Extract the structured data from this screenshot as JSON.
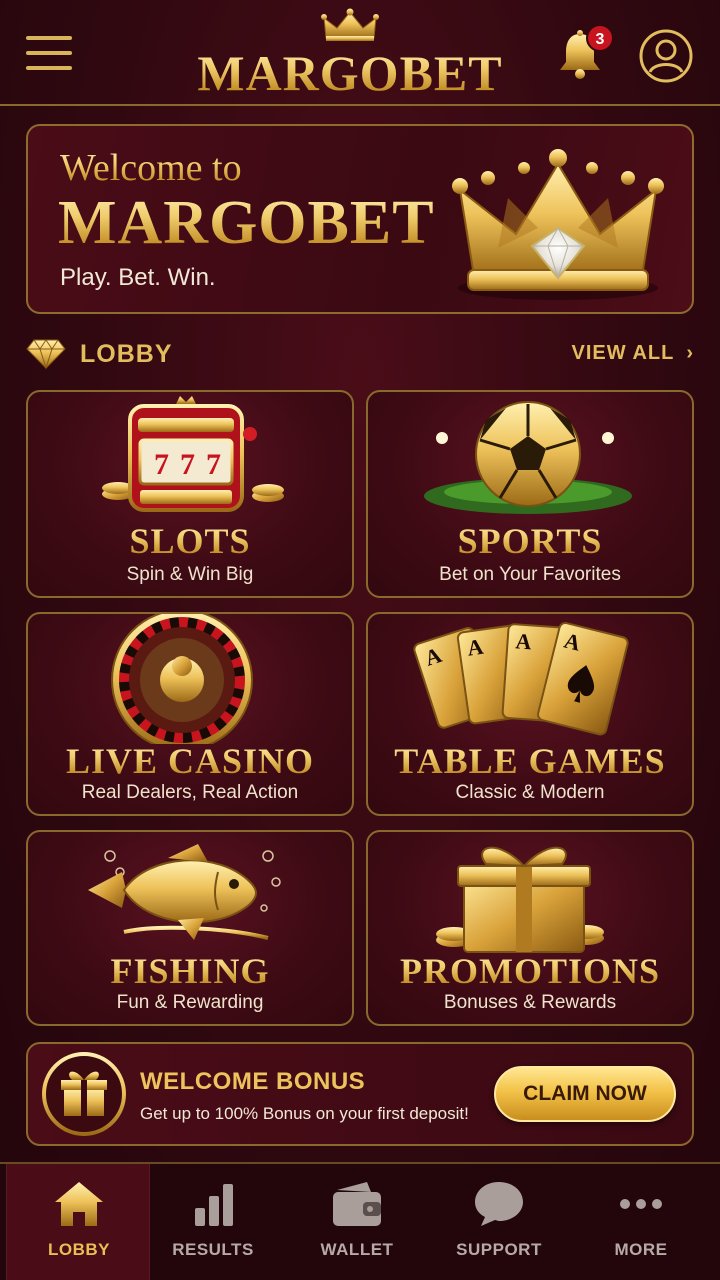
{
  "header": {
    "brand": "MARGOBET",
    "notification_count": "3"
  },
  "banner": {
    "line1": "Welcome to",
    "line2": "MARGOBET",
    "line3": "Play. Bet. Win."
  },
  "lobby": {
    "title": "LOBBY",
    "view_all": "VIEW ALL",
    "tiles": [
      {
        "title": "SLOTS",
        "subtitle": "Spin & Win Big",
        "icon": "slot-machine-icon"
      },
      {
        "title": "SPORTS",
        "subtitle": "Bet on Your Favorites",
        "icon": "soccer-ball-icon"
      },
      {
        "title": "LIVE CASINO",
        "subtitle": "Real Dealers, Real Action",
        "icon": "roulette-wheel-icon"
      },
      {
        "title": "TABLE GAMES",
        "subtitle": "Classic & Modern",
        "icon": "playing-cards-icon"
      },
      {
        "title": "FISHING",
        "subtitle": "Fun & Rewarding",
        "icon": "golden-fish-icon"
      },
      {
        "title": "PROMOTIONS",
        "subtitle": "Bonuses & Rewards",
        "icon": "gift-box-icon"
      }
    ]
  },
  "bonus": {
    "title": "WELCOME BONUS",
    "description": "Get up to 100% Bonus on your first deposit!",
    "button": "CLAIM NOW"
  },
  "nav": {
    "items": [
      {
        "label": "LOBBY",
        "icon": "home-icon",
        "active": true
      },
      {
        "label": "RESULTS",
        "icon": "bar-chart-icon",
        "active": false
      },
      {
        "label": "WALLET",
        "icon": "wallet-icon",
        "active": false
      },
      {
        "label": "SUPPORT",
        "icon": "chat-bubble-icon",
        "active": false
      },
      {
        "label": "MORE",
        "icon": "more-dots-icon",
        "active": false
      }
    ]
  },
  "colors": {
    "background": "#300810",
    "gold": "#e2bd5e",
    "accent_red": "#c8141e",
    "border": "#8a6a2c"
  }
}
